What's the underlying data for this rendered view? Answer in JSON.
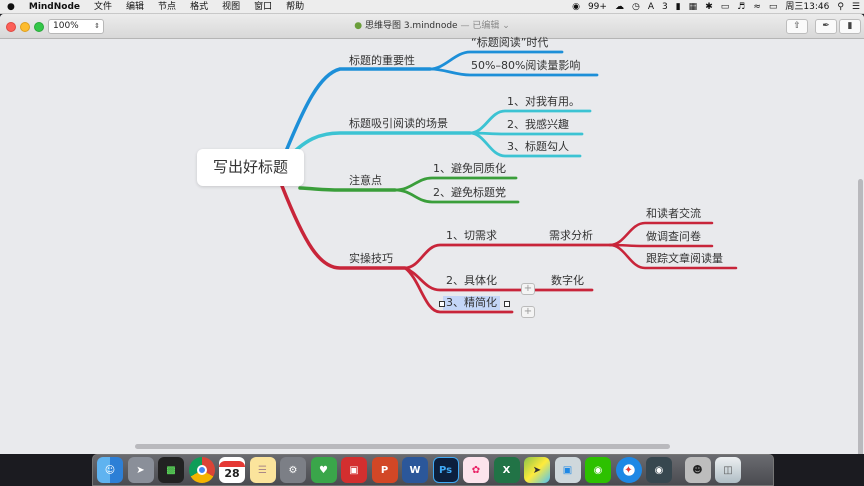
{
  "menubar": {
    "apple": "",
    "app_name": "MindNode",
    "items": [
      "文件",
      "编辑",
      "节点",
      "格式",
      "视图",
      "窗口",
      "帮助"
    ],
    "status": {
      "battery_pct": "99+",
      "a_count": "3",
      "clock": "周三13:46"
    }
  },
  "window": {
    "title": "思维导图 3.mindnode",
    "edited": "— 已编辑",
    "zoom": "100%"
  },
  "mindmap": {
    "root": "写出好标题",
    "b1": "标题的重要性",
    "b1_1": "“标题阅读”时代",
    "b1_2": "50%–80%阅读量影响",
    "b2": "标题吸引阅读的场景",
    "b2_1": "1、对我有用。",
    "b2_2": "2、我感兴趣",
    "b2_3": "3、标题勾人",
    "b3": "注意点",
    "b3_1": "1、避免同质化",
    "b3_2": "2、避免标题党",
    "b4": "实操技巧",
    "b4_1": "1、切需求",
    "b4_1_1": "需求分析",
    "b4_1_1_1": "和读者交流",
    "b4_1_1_2": "做调查问卷",
    "b4_1_1_3": "跟踪文章阅读量",
    "b4_2": "2、具体化",
    "b4_2_1": "数字化",
    "b4_3": "3、精简化"
  },
  "colors": {
    "blue": "#1d8fd8",
    "cyan": "#3cc3d3",
    "green": "#3a9e3a",
    "red": "#c8253a"
  },
  "dock": {
    "items": [
      "finder-icon",
      "launchpad-icon",
      "activity-monitor-icon",
      "chrome-icon",
      "calendar-icon",
      "notes-icon",
      "system-preferences-icon",
      "evernote-icon",
      "bank-icon",
      "powerpoint-icon",
      "word-icon",
      "photoshop-icon",
      "mindnode-icon",
      "excel-icon",
      "maps-icon",
      "preview-icon",
      "wechat-icon",
      "safari-icon",
      "photo-booth-icon",
      "user-avatar-icon",
      "trash-icon"
    ],
    "calendar_day": "28"
  }
}
